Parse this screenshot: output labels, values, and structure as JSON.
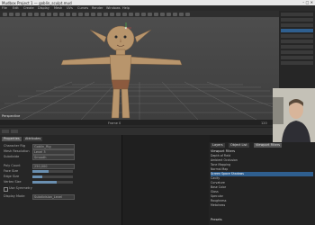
{
  "window": {
    "title": "Mudbox Project 1 — goblin_sculpt.mud",
    "controls": [
      "–",
      "□",
      "✕"
    ]
  },
  "menu": [
    "File",
    "Edit",
    "Create",
    "Display",
    "Mesh",
    "UVs",
    "Curves",
    "Render",
    "Windows",
    "Help"
  ],
  "toolbar": {
    "tools": [
      "select",
      "move",
      "rotate",
      "scale",
      "brush",
      "smooth",
      "grab",
      "pinch",
      "flatten",
      "foamy",
      "spray",
      "repeat",
      "imprint",
      "wax",
      "scrape",
      "fill",
      "knife",
      "smear",
      "bulge",
      "amplify",
      "freeze",
      "mask",
      "erase",
      "sculpt",
      "paint",
      "dodge",
      "burn",
      "clone",
      "blur",
      "sponge"
    ]
  },
  "viewport": {
    "label": "Perspective",
    "camera_label": "Camera 1"
  },
  "timeline": {
    "current": "Frame 0",
    "end": "120"
  },
  "left_panel": {
    "tabs": [
      "Properties",
      "Attributes"
    ],
    "fields": [
      {
        "label": "Character Rig",
        "value": "Goblin_Rig"
      },
      {
        "label": "Mesh Resolution",
        "value": "Level 3"
      },
      {
        "label": "Subdivide",
        "value": "Smooth"
      },
      {
        "label": "Poly Count",
        "value": "250,000"
      },
      {
        "label": "Face Size",
        "value": "1.0"
      },
      {
        "label": "Edge Size",
        "value": "0.5"
      },
      {
        "label": "Vertex Size",
        "value": "2.0"
      }
    ],
    "checkbox": "Use Symmetry",
    "dropdown_label": "Display Mode",
    "dropdown_value": "Subdivision_Level"
  },
  "attribute_panel": {
    "tabs": [
      "Layers",
      "Object List",
      "Viewport Filters"
    ],
    "header": "Viewport Filters",
    "items": [
      {
        "label": "Depth of Field",
        "selected": false
      },
      {
        "label": "Ambient Occlusion",
        "selected": false
      },
      {
        "label": "Tone Mapping",
        "selected": false
      },
      {
        "label": "Normal Map",
        "selected": false
      },
      {
        "label": "Screen Space Shadows",
        "selected": true
      },
      {
        "label": "Cavity",
        "selected": false
      },
      {
        "label": "Curvature",
        "selected": false
      },
      {
        "label": "Base Color",
        "selected": false
      },
      {
        "label": "Gloss",
        "selected": false
      },
      {
        "label": "Specular",
        "selected": false
      },
      {
        "label": "Roughness",
        "selected": false
      },
      {
        "label": "Metalness",
        "selected": false
      }
    ],
    "footer": "Presets"
  },
  "colors": {
    "accent": "#2f5f8f",
    "viewport": "#4a4a4a",
    "skin": "#b8956c",
    "grid": "#7a7a7a"
  }
}
